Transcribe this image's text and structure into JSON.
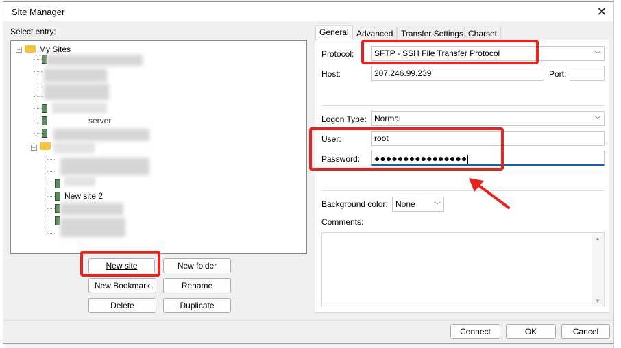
{
  "window": {
    "title": "Site Manager"
  },
  "tree": {
    "label": "Select entry:",
    "root": "My Sites",
    "visible_entries": [
      "server",
      "New site 2"
    ]
  },
  "left_buttons": {
    "new_site": "New site",
    "new_folder": "New folder",
    "new_bookmark": "New Bookmark",
    "rename": "Rename",
    "delete": "Delete",
    "duplicate": "Duplicate"
  },
  "tabs": [
    "General",
    "Advanced",
    "Transfer Settings",
    "Charset"
  ],
  "general": {
    "protocol_label": "Protocol:",
    "protocol_value": "SFTP - SSH File Transfer Protocol",
    "host_label": "Host:",
    "host_value": "207.246.99.239",
    "port_label": "Port:",
    "port_value": "",
    "logon_label": "Logon Type:",
    "logon_value": "Normal",
    "user_label": "User:",
    "user_value": "root",
    "password_label": "Password:",
    "password_value": "●●●●●●●●●●●●●●●●",
    "bgcolor_label": "Background color:",
    "bgcolor_value": "None",
    "comments_label": "Comments:"
  },
  "bottom_buttons": {
    "connect": "Connect",
    "ok": "OK",
    "cancel": "Cancel"
  },
  "annotation_color": "#e8231e"
}
